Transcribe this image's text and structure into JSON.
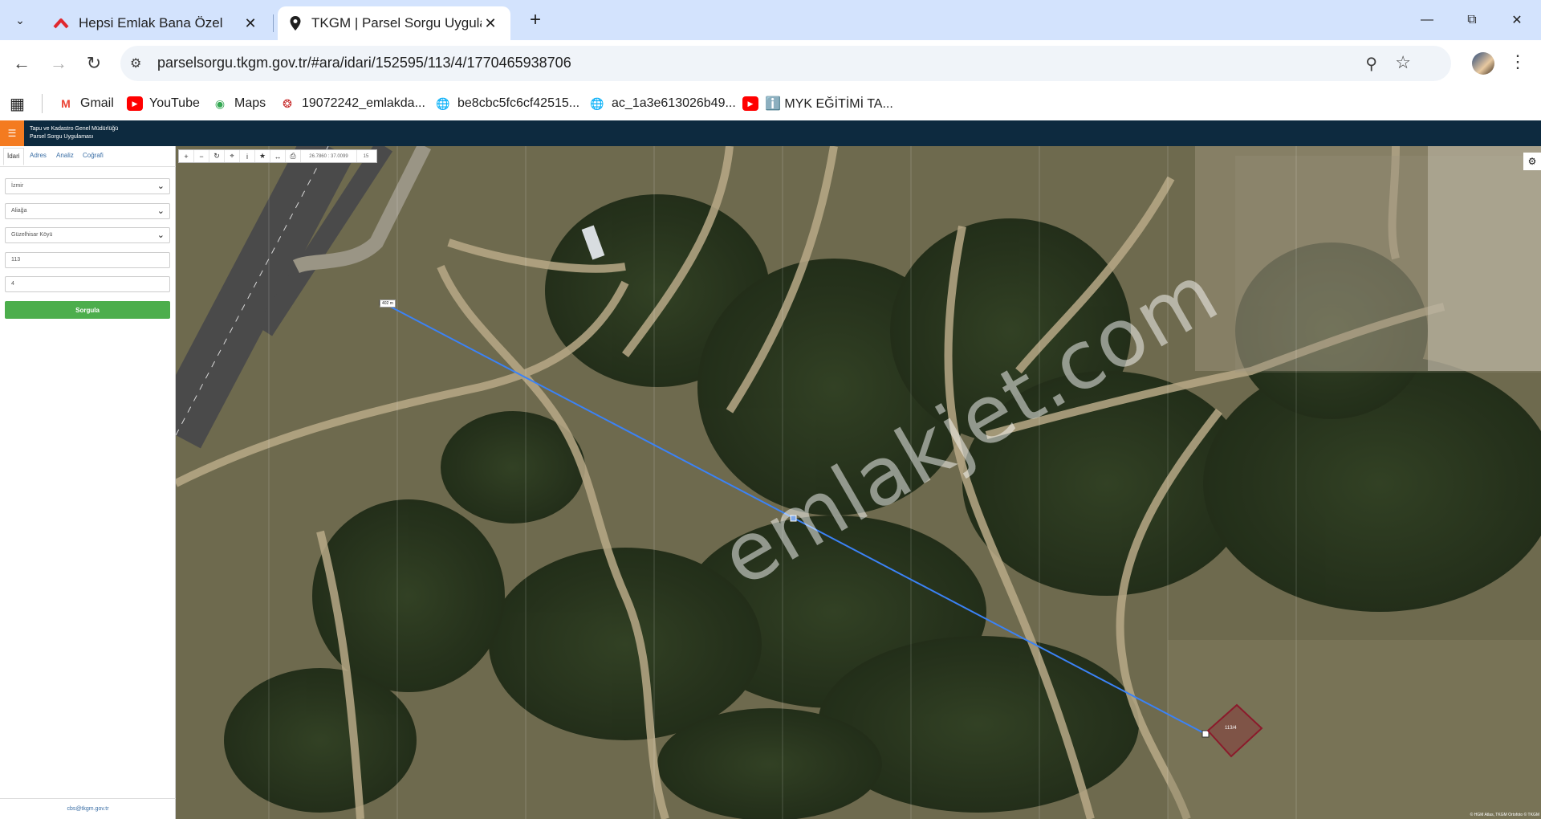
{
  "browser": {
    "tabs": [
      {
        "title": "Hepsi Emlak Bana Özel",
        "icon": "hepsiemlak-logo-icon",
        "active": false
      },
      {
        "title": "TKGM | Parsel Sorgu Uygulaması",
        "icon": "map-pin-icon",
        "active": true
      }
    ],
    "url": "parselsorgu.tkgm.gov.tr/#ara/idari/152595/113/4/1770465938706",
    "bookmarks": [
      {
        "label": "Gmail",
        "icon": "gmail-icon"
      },
      {
        "label": "YouTube",
        "icon": "youtube-icon"
      },
      {
        "label": "Maps",
        "icon": "maps-icon"
      },
      {
        "label": "19072242_emlakda...",
        "icon": "seal-icon"
      },
      {
        "label": "be8cbc5fc6cf42515...",
        "icon": "globe-icon"
      },
      {
        "label": "ac_1a3e613026b49...",
        "icon": "globe-icon"
      },
      {
        "label": "ℹ️ MYK EĞİTİMİ TA...",
        "icon": "youtube-icon"
      }
    ]
  },
  "app": {
    "title_line1": "Tapu ve Kadastro Genel Müdürlüğü",
    "title_line2": "Parsel Sorgu Uygulaması"
  },
  "sidebar": {
    "tabs": [
      "İdari",
      "Adres",
      "Analiz",
      "Coğrafi"
    ],
    "active_tab": "İdari",
    "province": "İzmir",
    "district": "Aliağa",
    "neighborhood": "Güzelhisar Köyü",
    "block": "113",
    "parcel": "4",
    "query_button": "Sorgula",
    "footer_email": "cbs@tkgm.gov.tr"
  },
  "map": {
    "coords": "26.7860 : 37.0099",
    "scale": "15",
    "distance_label": "402 m",
    "parcel_label": "113/4",
    "watermark": "emlakjet.com",
    "attribution": "© HGM Atlas, TKGM Ortofoto © TKGM",
    "line_color": "#3b82f6",
    "parcel_color": "#8b1a2b"
  }
}
